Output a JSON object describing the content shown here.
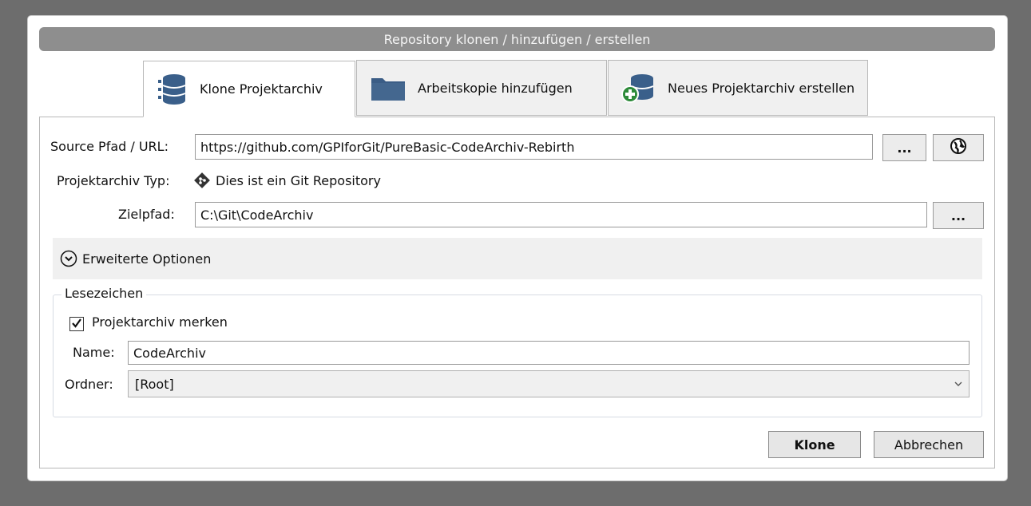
{
  "window": {
    "title": "Repository klonen / hinzufügen / erstellen"
  },
  "tabs": [
    {
      "label": "Klone Projektarchiv",
      "icon": "database-icon",
      "active": true
    },
    {
      "label": "Arbeitskopie hinzufügen",
      "icon": "folder-icon",
      "active": false
    },
    {
      "label": "Neues Projektarchiv erstellen",
      "icon": "database-add-icon",
      "active": false
    }
  ],
  "form": {
    "source_label": "Source Pfad / URL:",
    "source_value": "https://github.com/GPIforGit/PureBasic-CodeArchiv-Rebirth",
    "browse_label": "...",
    "type_label": "Projektarchiv Typ:",
    "type_value": "Dies ist ein Git Repository",
    "target_label": "Zielpfad:",
    "target_value": "C:\\Git\\CodeArchiv"
  },
  "advanced": {
    "label": "Erweiterte Optionen"
  },
  "bookmark": {
    "legend": "Lesezeichen",
    "remember_label": "Projektarchiv merken",
    "remember_checked": true,
    "name_label": "Name:",
    "name_value": "CodeArchiv",
    "folder_label": "Ordner:",
    "folder_value": "[Root]"
  },
  "buttons": {
    "clone": "Klone",
    "cancel": "Abbrechen"
  }
}
